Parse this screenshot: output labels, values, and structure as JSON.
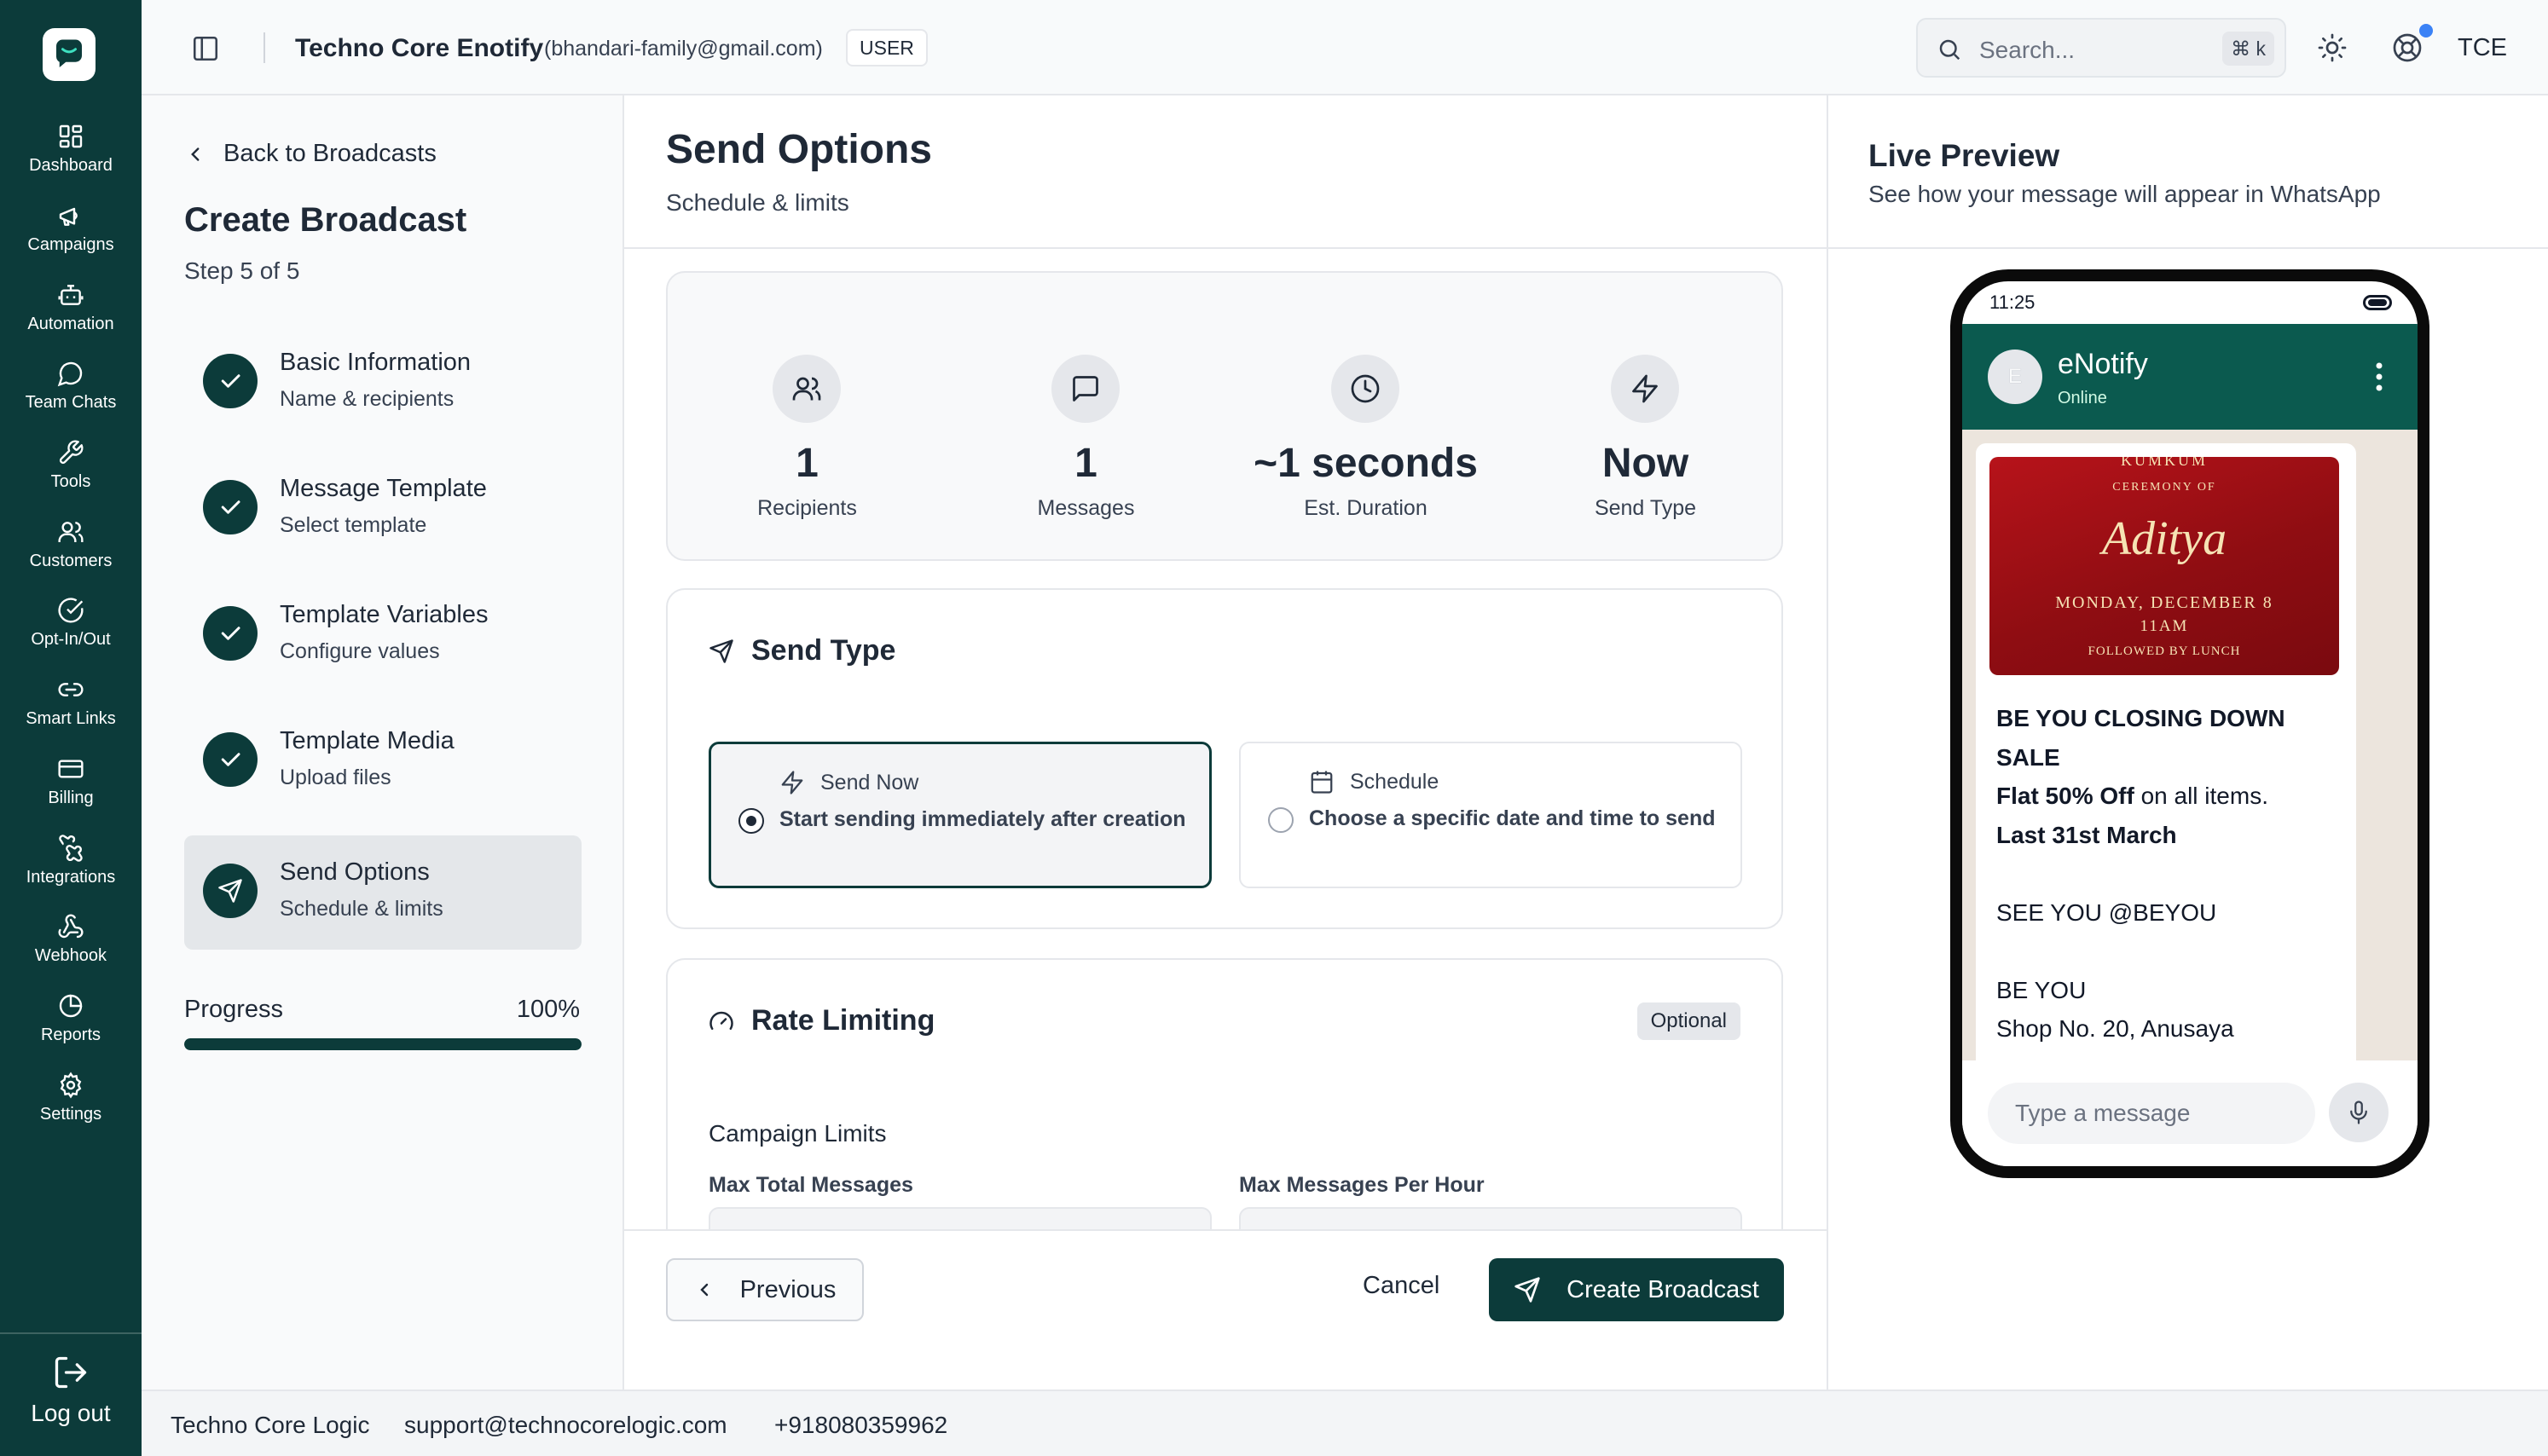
{
  "rail": {
    "items": [
      {
        "label": "Dashboard",
        "icon": "grid-icon"
      },
      {
        "label": "Campaigns",
        "icon": "megaphone-icon"
      },
      {
        "label": "Automation",
        "icon": "bot-icon"
      },
      {
        "label": "Team Chats",
        "icon": "chat-bubble-icon"
      },
      {
        "label": "Tools",
        "icon": "wrench-icon"
      },
      {
        "label": "Customers",
        "icon": "users-icon"
      },
      {
        "label": "Opt-In/Out",
        "icon": "check-circle-icon"
      },
      {
        "label": "Smart Links",
        "icon": "link-icon"
      },
      {
        "label": "Billing",
        "icon": "credit-card-icon"
      },
      {
        "label": "Integrations",
        "icon": "puzzle-icon"
      },
      {
        "label": "Webhook",
        "icon": "webhook-icon"
      },
      {
        "label": "Reports",
        "icon": "pie-chart-icon"
      },
      {
        "label": "Settings",
        "icon": "gear-icon"
      }
    ],
    "logout_label": "Log out"
  },
  "topbar": {
    "org_name": "Techno Core Enotify",
    "email": "(bhandari-family@gmail.com)",
    "role_badge": "USER",
    "search_placeholder": "Search...",
    "search_shortcut": "⌘ k",
    "user_initials": "TCE"
  },
  "wizard": {
    "back_label": "Back to Broadcasts",
    "title": "Create Broadcast",
    "step_counter": "Step 5 of 5",
    "steps": [
      {
        "title": "Basic Information",
        "desc": "Name & recipients",
        "status": "done"
      },
      {
        "title": "Message Template",
        "desc": "Select template",
        "status": "done"
      },
      {
        "title": "Template Variables",
        "desc": "Configure values",
        "status": "done"
      },
      {
        "title": "Template Media",
        "desc": "Upload files",
        "status": "done"
      },
      {
        "title": "Send Options",
        "desc": "Schedule & limits",
        "status": "active"
      }
    ],
    "progress_label": "Progress",
    "progress_text": "100%",
    "progress_value": 1.0
  },
  "main": {
    "title": "Send Options",
    "subtitle": "Schedule & limits",
    "stats": [
      {
        "value": "1",
        "label": "Recipients",
        "icon": "users-icon"
      },
      {
        "value": "1",
        "label": "Messages",
        "icon": "message-square-icon"
      },
      {
        "value": "~1 seconds",
        "label": "Est. Duration",
        "icon": "clock-icon"
      },
      {
        "value": "Now",
        "label": "Send Type",
        "icon": "lightning-icon"
      }
    ],
    "send_type": {
      "title": "Send Type",
      "options": [
        {
          "label": "Send Now",
          "desc": "Start sending immediately after creation",
          "selected": true,
          "icon": "lightning-icon"
        },
        {
          "label": "Schedule",
          "desc": "Choose a specific date and time to send",
          "selected": false,
          "icon": "calendar-icon"
        }
      ]
    },
    "rate_limiting": {
      "title": "Rate Limiting",
      "badge": "Optional",
      "section_label": "Campaign Limits",
      "field_max_total": "Max Total Messages",
      "field_max_hour": "Max Messages Per Hour"
    },
    "footer": {
      "previous_label": "Previous",
      "cancel_label": "Cancel",
      "create_label": "Create Broadcast"
    }
  },
  "preview": {
    "title": "Live Preview",
    "subtitle": "See how your message will appear in WhatsApp",
    "phone_time": "11:25",
    "contact_initial": "E",
    "contact_name": "eNotify",
    "contact_status": "Online",
    "media_lines": [
      "KUMKUM",
      "CEREMONY OF",
      "Aditya",
      "MONDAY, DECEMBER 8",
      "11AM",
      "FOLLOWED BY LUNCH"
    ],
    "message": {
      "line1_bold": "BE YOU CLOSING DOWN SALE",
      "line2_bold": "Flat 50% Off",
      "line2_rest": " on all items.",
      "line3_bold": "Last 31st March",
      "line4": "SEE YOU @BEYOU",
      "line5": "BE YOU",
      "line6": "Shop No. 20, Anusaya"
    },
    "input_placeholder": "Type a message"
  },
  "footer": {
    "company": "Techno Core Logic",
    "email": "support@technocorelogic.com",
    "phone": "+918080359962"
  },
  "colors": {
    "primary": "#0c3b3a",
    "whatsapp_header": "#0b5a4f",
    "notification_dot": "#3b82f6"
  }
}
